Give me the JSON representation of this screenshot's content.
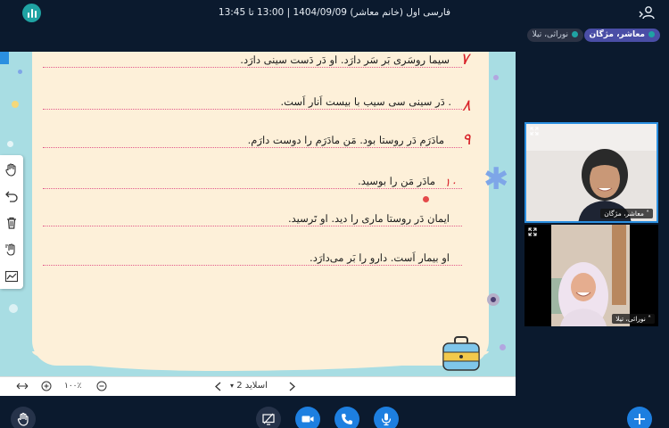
{
  "header": {
    "title": "فارسی اول (خانم معاشر) 1404/09/09 | 13:00 تا 13:45",
    "app_icon": "bar-chart-icon",
    "users_icon": "users-icon"
  },
  "talkers": [
    {
      "name": "معاشر، مژگان"
    },
    {
      "name": "نوراثی، تیلا"
    }
  ],
  "presentation": {
    "lines": [
      {
        "number": "۷",
        "text": "سیما روسَری بَر سَر دارَد. او دَر دَست سینی دارَد."
      },
      {
        "number": "۸",
        "text": ". دَر سینی سی سیب با بیست اَنار اَست."
      },
      {
        "number": "۹",
        "text": "مادَرَم دَر روستا بود. مَن مادَرَم را دوست دارَم."
      },
      {
        "number": "۱۰",
        "text": "مادَر مَن را بوسید."
      },
      {
        "number": "",
        "text": "ایمان دَر روستا ماری را دید. او تَرسید."
      },
      {
        "number": "",
        "text": "او بیمار اَست. دارو را بَر می‌دارَد."
      }
    ],
    "tools": [
      {
        "icon": "hand-pan-icon"
      },
      {
        "icon": "undo-icon"
      },
      {
        "icon": "trash-icon"
      },
      {
        "icon": "multi-user-whiteboard-icon"
      },
      {
        "icon": "chart-line-icon"
      }
    ]
  },
  "pres_footer": {
    "slide_label": "اسلاید 2",
    "prev_icon": "chevron-left-icon",
    "next_icon": "chevron-right-icon",
    "zoom": "۱۰۰٪",
    "fit_icon": "fit-width-icon",
    "zoom_in_icon": "plus-circle-icon",
    "zoom_out_icon": "minus-circle-icon"
  },
  "webcams": [
    {
      "name": "معاشر، مژگان"
    },
    {
      "name": "نوراثی، تیلا"
    }
  ],
  "bottom_bar": {
    "left_button": "raise-hand-icon",
    "center_buttons": [
      "screen-share-off-icon",
      "video-icon",
      "phone-icon",
      "microphone-icon"
    ],
    "right_button": "plus-icon"
  }
}
